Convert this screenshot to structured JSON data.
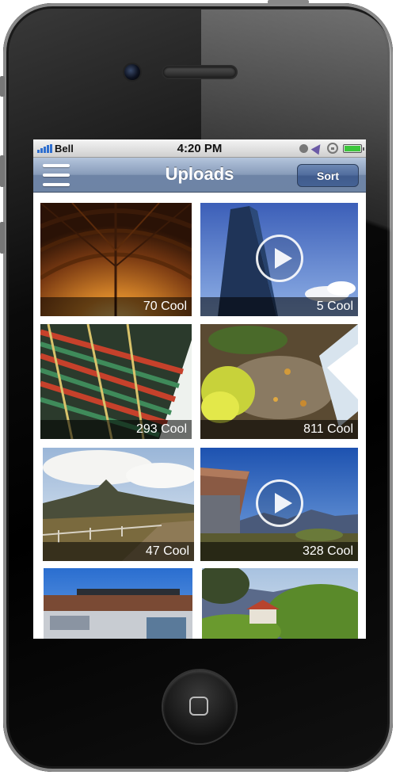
{
  "status_bar": {
    "carrier": "Bell",
    "time": "4:20 PM"
  },
  "nav": {
    "title": "Uploads",
    "sort_label": "Sort"
  },
  "tiles": [
    {
      "cool": "70 Cool",
      "scene": "wooden chapel ceiling",
      "video": false
    },
    {
      "cool": "5 Cool",
      "scene": "glass skyscraper against blue sky",
      "video": true
    },
    {
      "cool": "293 Cool",
      "scene": "painted temple eaves",
      "video": false
    },
    {
      "cool": "811 Cool",
      "scene": "autumn leaves on rocks by waterfall",
      "video": false
    },
    {
      "cool": "47 Cool",
      "scene": "mountain trail with fence",
      "video": false
    },
    {
      "cool": "328 Cool",
      "scene": "building with mountains",
      "video": true
    },
    {
      "cool": "",
      "scene": "solar panel building",
      "video": false
    },
    {
      "cool": "",
      "scene": "house among trees with mountains",
      "video": false
    }
  ],
  "colors": {
    "nav_top": "#b4c5dc",
    "nav_bottom": "#6e84a5",
    "sort_button": "#4f6b9c",
    "battery": "#3cc63c"
  },
  "icons": [
    "menu-icon",
    "signal-bars-icon",
    "clock-icon",
    "location-arrow-icon",
    "rotation-lock-icon",
    "battery-icon",
    "play-icon",
    "home-button-icon"
  ]
}
